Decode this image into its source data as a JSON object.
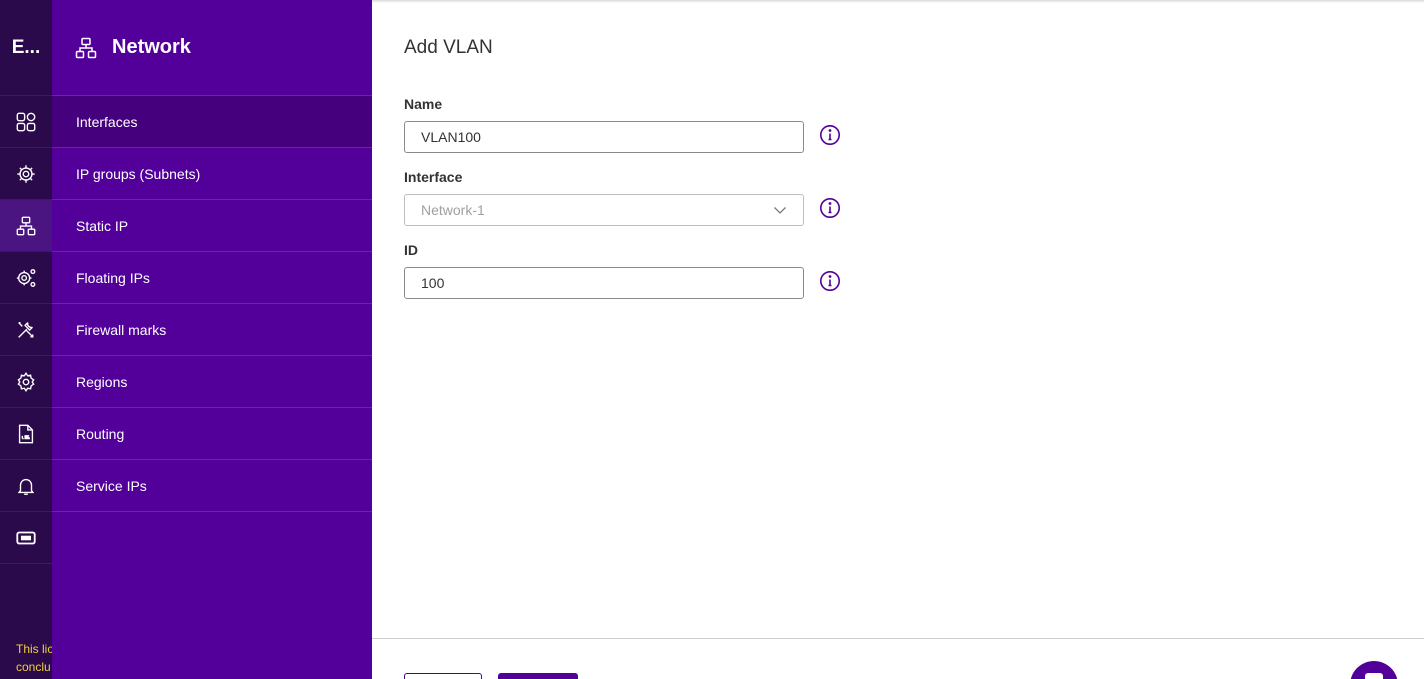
{
  "rail": {
    "logo": "E...",
    "items": [
      {
        "icon": "dashboard-icon"
      },
      {
        "icon": "settings-gear-icon"
      },
      {
        "icon": "network-icon"
      },
      {
        "icon": "gears-icon"
      },
      {
        "icon": "tools-icon"
      },
      {
        "icon": "gear-icon"
      },
      {
        "icon": "log-file-icon"
      },
      {
        "icon": "bell-icon"
      },
      {
        "icon": "ticket-icon"
      }
    ],
    "footer_lines": [
      "This lic",
      "conclu"
    ]
  },
  "sidebar": {
    "title": "Network",
    "items": [
      {
        "label": "Interfaces"
      },
      {
        "label": "IP groups (Subnets)"
      },
      {
        "label": "Static IP"
      },
      {
        "label": "Floating IPs"
      },
      {
        "label": "Firewall marks"
      },
      {
        "label": "Regions"
      },
      {
        "label": "Routing"
      },
      {
        "label": "Service IPs"
      }
    ]
  },
  "form": {
    "title": "Add VLAN",
    "name_label": "Name",
    "name_value": "VLAN100",
    "interface_label": "Interface",
    "interface_value": "Network-1",
    "id_label": "ID",
    "id_value": "100"
  },
  "colors": {
    "accent": "#53009b",
    "rail": "#2a0a4a",
    "warning_text": "#f0d040"
  }
}
